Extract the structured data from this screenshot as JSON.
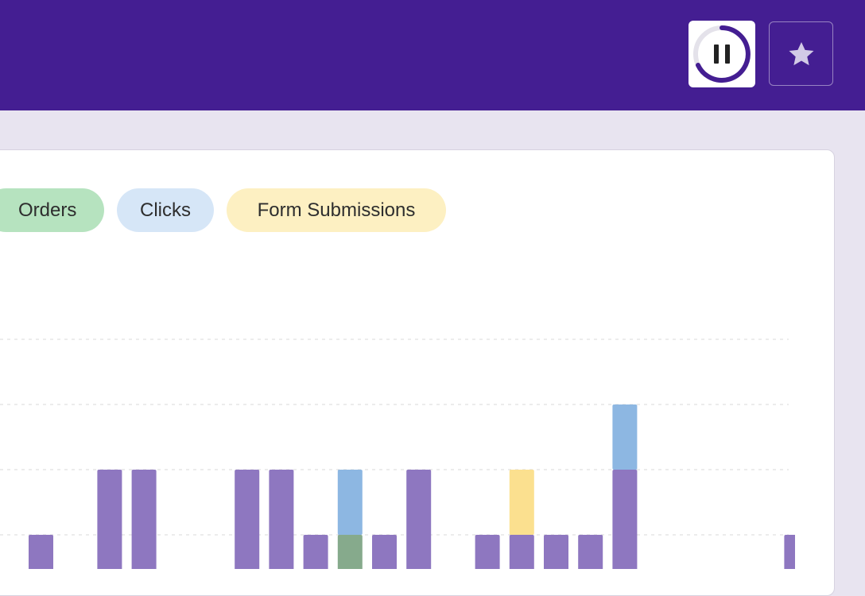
{
  "header": {
    "pause_icon": "pause-icon",
    "favorite_icon": "star-icon",
    "colors": {
      "background": "#441e92",
      "ring": "#441e92",
      "ring_track": "#e4e2ea"
    }
  },
  "legend": [
    {
      "label": "Orders",
      "color": "#b6e3bf"
    },
    {
      "label": "Clicks",
      "color": "#d6e6f7"
    },
    {
      "label": "Form Submissions",
      "color": "#fdf0c2"
    }
  ],
  "chart_data": {
    "type": "bar",
    "stacked": true,
    "ylim": [
      0,
      4.5
    ],
    "grid": true,
    "x": [
      0,
      1,
      2,
      3,
      4,
      5,
      6,
      7,
      8,
      9,
      10,
      11,
      12,
      13,
      14,
      15,
      16,
      17,
      18,
      19,
      20,
      21,
      22
    ],
    "series": [
      {
        "key": "base",
        "color": "#8e77c0",
        "values": [
          1,
          0,
          2,
          2,
          0,
          0,
          2,
          2,
          1,
          0,
          1,
          2,
          0,
          1,
          1,
          1,
          1,
          2,
          0,
          0,
          0,
          0,
          1
        ]
      },
      {
        "name": "Orders",
        "color": "#86aa8c",
        "values": [
          0,
          0,
          0,
          0,
          0,
          0,
          0,
          0,
          0,
          1,
          0,
          0,
          0,
          0,
          0,
          0,
          0,
          0,
          0,
          0,
          0,
          0,
          0
        ]
      },
      {
        "name": "Clicks",
        "color": "#8db7e2",
        "values": [
          0,
          0,
          0,
          0,
          0,
          0,
          0,
          0,
          0,
          1,
          0,
          0,
          0,
          0,
          0,
          0,
          0,
          1,
          0,
          0,
          0,
          0,
          0
        ]
      },
      {
        "name": "Form Submissions",
        "color": "#fbe08f",
        "values": [
          0,
          0,
          0,
          0,
          0,
          0,
          0,
          0,
          0,
          0,
          0,
          0,
          0,
          0,
          1,
          0,
          0,
          0,
          0,
          0,
          0,
          0,
          0
        ]
      }
    ]
  }
}
